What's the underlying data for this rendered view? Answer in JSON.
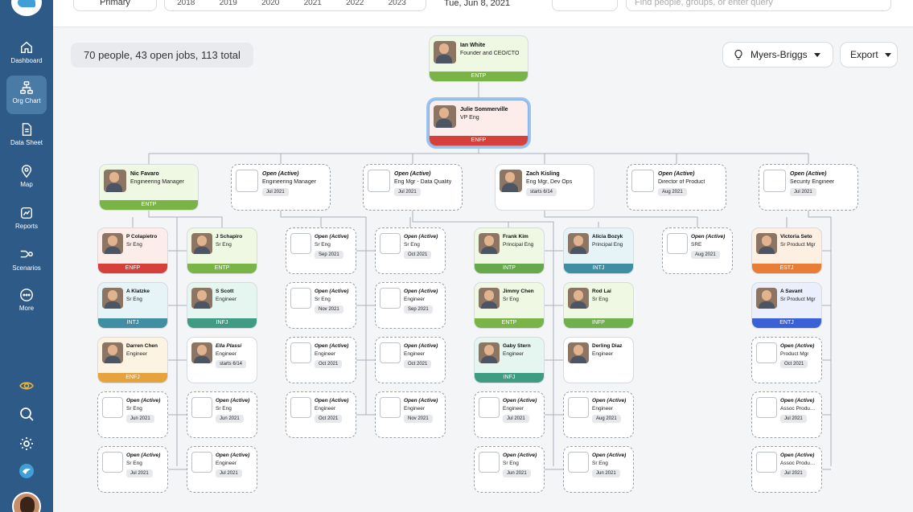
{
  "sidebar": {
    "items": [
      {
        "label": "Dashboard",
        "icon": "home-icon"
      },
      {
        "label": "Org Chart",
        "icon": "org-chart-icon"
      },
      {
        "label": "Data Sheet",
        "icon": "data-sheet-icon"
      },
      {
        "label": "Map",
        "icon": "map-pin-icon"
      },
      {
        "label": "Reports",
        "icon": "reports-icon"
      },
      {
        "label": "Scenarios",
        "icon": "scenarios-icon"
      },
      {
        "label": "More",
        "icon": "more-icon"
      }
    ],
    "utility_icons": [
      "eye-icon",
      "search-icon",
      "gear-icon",
      "logo-icon"
    ],
    "accent": "#2d5a86"
  },
  "topbar": {
    "view_select": "Primary",
    "years": [
      "2018",
      "2019",
      "2020",
      "2021",
      "2022",
      "2023"
    ],
    "date": "Tue, Jun 8, 2021",
    "search_placeholder": "Find people, groups, or enter query"
  },
  "summary": "70 people, 43 open jobs, 113 total",
  "controls": {
    "personality": "Myers-Briggs",
    "export": "Export"
  },
  "mbti_colors": {
    "ENTP": "#7bb446",
    "ENFP": "#d6403a",
    "INTP": "#65a94a",
    "INTJ": "#3f8ea1",
    "INFJ": "#3f9c82",
    "ESTJ": "#e97d35",
    "ENTJ": "#3a62d6",
    "ENFJ": "#e6a23c",
    "INFP": "#6fb04c"
  },
  "cards": [
    {
      "id": "ceo",
      "name": "Ian White",
      "title": "Founder and CEO/CTO",
      "mbti": "ENTP",
      "bg": "#eef8e2",
      "big": true
    },
    {
      "id": "vp",
      "name": "Julie Sommerville",
      "title": "VP Eng",
      "mbti": "ENFP",
      "bg": "#fcecea",
      "big": true,
      "selected": true
    },
    {
      "id": "m1",
      "name": "Nic Favaro",
      "title": "Engineering Manager",
      "mbti": "ENTP",
      "bg": "#eef8e2",
      "big": true
    },
    {
      "id": "m2",
      "name": "Open (Active)",
      "title": "Engineering Manager",
      "date": "Jul 2021",
      "open": true,
      "big": true
    },
    {
      "id": "m3",
      "name": "Open (Active)",
      "title": "Eng Mgr - Data Quality",
      "date": "Jul 2021",
      "open": true,
      "big": true
    },
    {
      "id": "m4",
      "name": "Zach Kisling",
      "title": "Eng Mgr, Dev Ops",
      "date": "starts 6/14",
      "bg": "#ffffff",
      "big": true
    },
    {
      "id": "m5",
      "name": "Open (Active)",
      "title": "Director of Product",
      "date": "Aug 2021",
      "open": true,
      "big": true
    },
    {
      "id": "m6",
      "name": "Open (Active)",
      "title": "Security Engineer",
      "date": "Jul 2021",
      "open": true,
      "big": true
    },
    {
      "id": "a1",
      "name": "P Colapietro",
      "title": "Sr Eng",
      "mbti": "ENFP",
      "bg": "#fcecea"
    },
    {
      "id": "a2",
      "name": "A Klatzke",
      "title": "Sr Eng",
      "mbti": "INTJ",
      "bg": "#e6f3f7"
    },
    {
      "id": "a3",
      "name": "Darren Chen",
      "title": "Engineer",
      "mbti": "ENFJ",
      "bg": "#fdf3e2"
    },
    {
      "id": "a4",
      "name": "Open (Active)",
      "title": "Sr Eng",
      "date": "Jun 2021",
      "open": true
    },
    {
      "id": "a5",
      "name": "Open (Active)",
      "title": "Sr Eng",
      "date": "Jul 2021",
      "open": true
    },
    {
      "id": "b1",
      "name": "J Schapiro",
      "title": "Sr Eng",
      "mbti": "ENTP",
      "bg": "#eef8e2"
    },
    {
      "id": "b2",
      "name": "S Scott",
      "title": "Engineer",
      "mbti": "INFJ",
      "bg": "#e5f5ef"
    },
    {
      "id": "b3",
      "name": "Ella Plassi",
      "title": "Engineer",
      "date": "starts 6/14",
      "bg": "#ffffff",
      "italic": true
    },
    {
      "id": "b4",
      "name": "Open (Active)",
      "title": "Sr Eng",
      "date": "Jun 2021",
      "open": true
    },
    {
      "id": "b5",
      "name": "Open (Active)",
      "title": "Engineer",
      "date": "Jul 2021",
      "open": true
    },
    {
      "id": "c1",
      "name": "Open (Active)",
      "title": "Sr Eng",
      "date": "Sep 2021",
      "open": true
    },
    {
      "id": "c2",
      "name": "Open (Active)",
      "title": "Sr Eng",
      "date": "Nov 2021",
      "open": true
    },
    {
      "id": "c3",
      "name": "Open (Active)",
      "title": "Engineer",
      "date": "Oct 2021",
      "open": true
    },
    {
      "id": "c4",
      "name": "Open (Active)",
      "title": "Engineer",
      "date": "Oct 2021",
      "open": true
    },
    {
      "id": "d1",
      "name": "Open (Active)",
      "title": "Sr Eng",
      "date": "Oct 2021",
      "open": true
    },
    {
      "id": "d2",
      "name": "Open (Active)",
      "title": "Engineer",
      "date": "Sep 2021",
      "open": true
    },
    {
      "id": "d3",
      "name": "Open (Active)",
      "title": "Engineer",
      "date": "Oct 2021",
      "open": true
    },
    {
      "id": "d4",
      "name": "Open (Active)",
      "title": "Engineer",
      "date": "Nov 2021",
      "open": true
    },
    {
      "id": "e1",
      "name": "Frank Kim",
      "title": "Principal Eng",
      "mbti": "INTP",
      "bg": "#eef8e2"
    },
    {
      "id": "e2",
      "name": "Jimmy Chen",
      "title": "Sr Eng",
      "mbti": "ENTP",
      "bg": "#eef8e2"
    },
    {
      "id": "e3",
      "name": "Gaby Stern",
      "title": "Engineer",
      "mbti": "INFJ",
      "bg": "#e5f5ef"
    },
    {
      "id": "e4",
      "name": "Open (Active)",
      "title": "Engineer",
      "date": "Jul 2021",
      "open": true
    },
    {
      "id": "e5",
      "name": "Open (Active)",
      "title": "Sr Eng",
      "date": "Jun 2021",
      "open": true
    },
    {
      "id": "f1",
      "name": "Alicia Bozyk",
      "title": "Principal Eng",
      "mbti": "INTJ",
      "bg": "#e6f3f7"
    },
    {
      "id": "f2",
      "name": "Rod Lai",
      "title": "Sr Eng",
      "mbti": "INFP",
      "bg": "#eef8e2"
    },
    {
      "id": "f3",
      "name": "Derling Diaz",
      "title": "Engineer",
      "bg": "#ffffff"
    },
    {
      "id": "f4",
      "name": "Open (Active)",
      "title": "Engineer",
      "date": "Aug 2021",
      "open": true
    },
    {
      "id": "f5",
      "name": "Open (Active)",
      "title": "Sr Eng",
      "date": "Jun 2021",
      "open": true
    },
    {
      "id": "g1",
      "name": "Open (Active)",
      "title": "SRE",
      "date": "Aug 2021",
      "open": true
    },
    {
      "id": "h1",
      "name": "Victoria Seto",
      "title": "Sr Product Mgr",
      "mbti": "ESTJ",
      "bg": "#fdf0e3"
    },
    {
      "id": "h2",
      "name": "A Savant",
      "title": "Sr Product Mgr",
      "mbti": "ENTJ",
      "bg": "#eaeffb"
    },
    {
      "id": "h3",
      "name": "Open (Active)",
      "title": "Product Mgr",
      "date": "Oct 2021",
      "open": true
    },
    {
      "id": "h4",
      "name": "Open (Active)",
      "title": "Assoc Produ…",
      "date": "Jul 2021",
      "open": true
    },
    {
      "id": "h5",
      "name": "Open (Active)",
      "title": "Assoc Produ…",
      "date": "Jul 2021",
      "open": true
    }
  ]
}
